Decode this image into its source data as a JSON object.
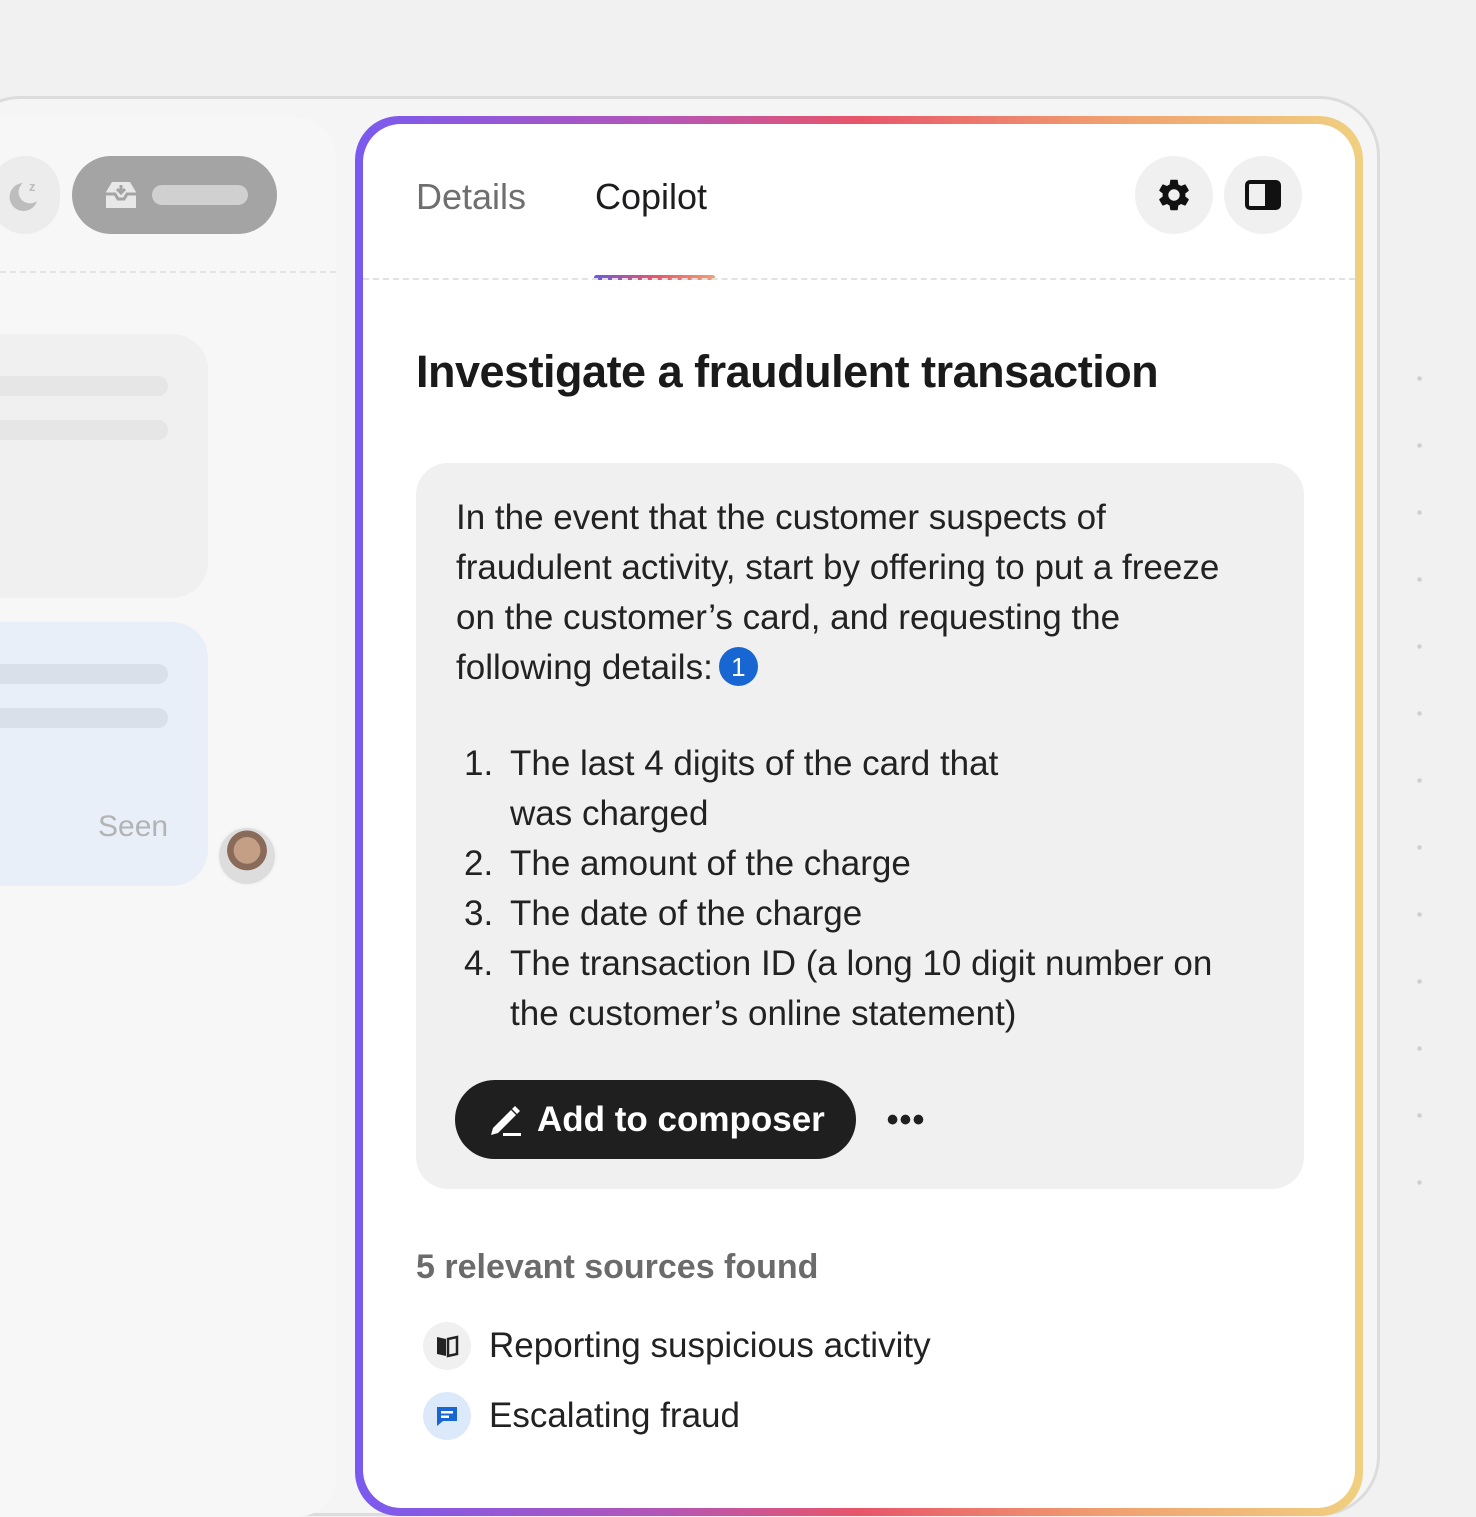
{
  "left_panel": {
    "seen_label": "Seen"
  },
  "copilot": {
    "tabs": [
      {
        "label": "Details",
        "active": false
      },
      {
        "label": "Copilot",
        "active": true
      }
    ],
    "title": "Investigate a fraudulent transaction",
    "answer": {
      "intro": "In the event that the customer suspects of fraudulent activity, start by offering to put a freeze on the customer’s card, and requesting the following details:",
      "citation": "1",
      "steps": [
        {
          "num": "1.",
          "text": "The last 4 digits of the card that was charged"
        },
        {
          "num": "2.",
          "text": "The amount of the charge"
        },
        {
          "num": "3.",
          "text": "The date of the charge"
        },
        {
          "num": "4.",
          "text": "The transaction ID (a long 10 digit number on the customer’s online statement)"
        }
      ],
      "add_button_label": "Add to composer",
      "more_label": "•••"
    },
    "sources_heading": "5 relevant sources found",
    "sources": [
      {
        "label": "Reporting suspicious activity",
        "icon": "book-icon"
      },
      {
        "label": "Escalating fraud",
        "icon": "chat-icon"
      }
    ]
  },
  "colors": {
    "citation_blue": "#1866d1",
    "button_dark": "#1f1f1f",
    "gradient": [
      "#7a5af0",
      "#e8556a",
      "#f0d080"
    ]
  }
}
